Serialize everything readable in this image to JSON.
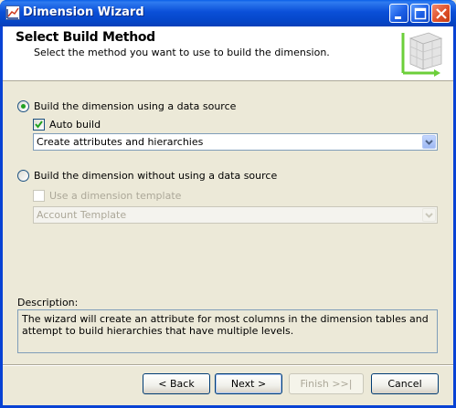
{
  "window": {
    "title": "Dimension Wizard"
  },
  "header": {
    "title": "Select Build Method",
    "subtitle": "Select the method you want to use to build the dimension."
  },
  "options": {
    "with_source": {
      "label": "Build the dimension using a data source",
      "selected": true,
      "auto_build": {
        "label": "Auto build",
        "checked": true
      },
      "build_combo": {
        "value": "Create attributes and hierarchies"
      }
    },
    "without_source": {
      "label": "Build the dimension without using a data source",
      "selected": false,
      "template_check": {
        "label": "Use a dimension template",
        "checked": false,
        "enabled": false
      },
      "template_combo": {
        "value": "Account Template",
        "enabled": false
      }
    }
  },
  "description": {
    "label": "Description:",
    "text": "The wizard will create an attribute for most columns in the dimension tables and attempt to build hierarchies that have multiple levels."
  },
  "buttons": {
    "back": "< Back",
    "next": "Next >",
    "finish": "Finish >>|",
    "cancel": "Cancel"
  },
  "colors": {
    "titlebar": "#0a4fd8",
    "radio_dot": "#21a121",
    "client_bg": "#ece9d8"
  }
}
